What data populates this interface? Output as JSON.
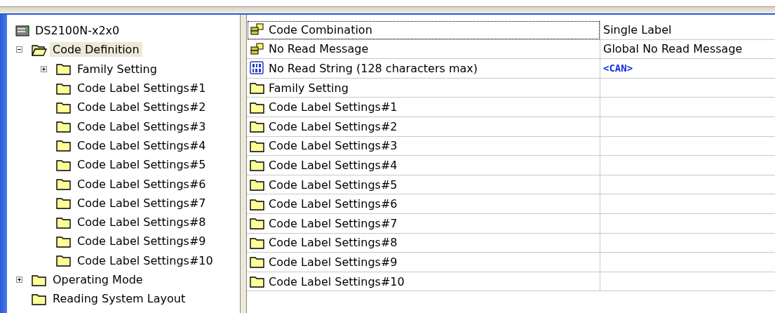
{
  "tree": [
    {
      "label": "DS2100N-x2x0",
      "kind": "device",
      "selected": false,
      "children": [
        {
          "label": "Code Definition",
          "kind": "folder",
          "selected": true,
          "expanded": true,
          "children": [
            {
              "label": "Family Setting",
              "kind": "folder",
              "selected": false,
              "expanded": false
            },
            {
              "label": "Code Label Settings#1",
              "kind": "folder",
              "selected": false
            },
            {
              "label": "Code Label Settings#2",
              "kind": "folder",
              "selected": false
            },
            {
              "label": "Code Label Settings#3",
              "kind": "folder",
              "selected": false
            },
            {
              "label": "Code Label Settings#4",
              "kind": "folder",
              "selected": false
            },
            {
              "label": "Code Label Settings#5",
              "kind": "folder",
              "selected": false
            },
            {
              "label": "Code Label Settings#6",
              "kind": "folder",
              "selected": false
            },
            {
              "label": "Code Label Settings#7",
              "kind": "folder",
              "selected": false
            },
            {
              "label": "Code Label Settings#8",
              "kind": "folder",
              "selected": false
            },
            {
              "label": "Code Label Settings#9",
              "kind": "folder",
              "selected": false
            },
            {
              "label": "Code Label Settings#10",
              "kind": "folder",
              "selected": false
            }
          ]
        },
        {
          "label": "Operating Mode",
          "kind": "folder",
          "selected": false,
          "expanded": false
        },
        {
          "label": "Reading System Layout",
          "kind": "folder",
          "selected": false
        }
      ]
    }
  ],
  "table": {
    "rows": [
      {
        "kind": "option",
        "name": "Code Combination",
        "value": "Single Label",
        "selected": true
      },
      {
        "kind": "option",
        "name": "No Read Message",
        "value": "Global No Read Message",
        "selected": false
      },
      {
        "kind": "string",
        "name": "No Read String (128 characters max)",
        "value": "<CAN>",
        "selected": false
      },
      {
        "kind": "folder",
        "name": "Family Setting",
        "selected": false
      },
      {
        "kind": "folder",
        "name": "Code Label Settings#1",
        "selected": false
      },
      {
        "kind": "folder",
        "name": "Code Label Settings#2",
        "selected": false
      },
      {
        "kind": "folder",
        "name": "Code Label Settings#3",
        "selected": false
      },
      {
        "kind": "folder",
        "name": "Code Label Settings#4",
        "selected": false
      },
      {
        "kind": "folder",
        "name": "Code Label Settings#5",
        "selected": false
      },
      {
        "kind": "folder",
        "name": "Code Label Settings#6",
        "selected": false
      },
      {
        "kind": "folder",
        "name": "Code Label Settings#7",
        "selected": false
      },
      {
        "kind": "folder",
        "name": "Code Label Settings#8",
        "selected": false
      },
      {
        "kind": "folder",
        "name": "Code Label Settings#9",
        "selected": false
      },
      {
        "kind": "folder",
        "name": "Code Label Settings#10",
        "selected": false
      }
    ]
  }
}
